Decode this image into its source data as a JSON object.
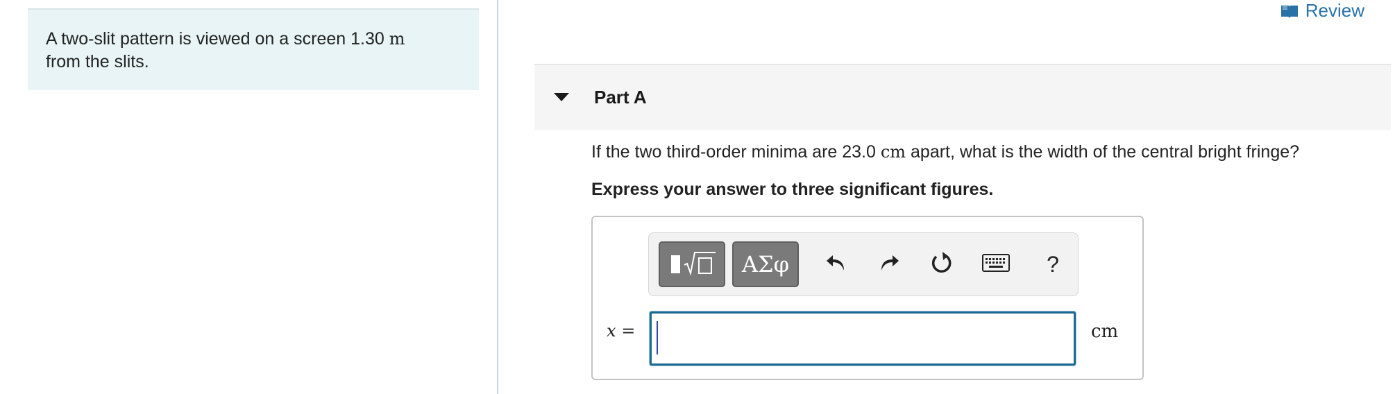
{
  "intro": {
    "text_before": "A two-slit pattern is viewed on a screen 1.30 ",
    "distance_unit": "m",
    "text_after": "from the slits."
  },
  "header": {
    "review_label": "Review",
    "review_icon": "book-icon"
  },
  "part": {
    "title": "Part A",
    "caret_icon": "caret-down-icon"
  },
  "question": {
    "text_before": "If the two third-order minima are 23.0 ",
    "unit": "cm",
    "text_after": " apart, what is the width of the central bright fringe?",
    "instruction": "Express your answer to three significant figures."
  },
  "toolbar": {
    "templates_icon": "templates-icon",
    "greek_label": "ΑΣφ",
    "undo_icon": "undo-icon",
    "redo_icon": "redo-icon",
    "reset_icon": "reset-icon",
    "keyboard_icon": "keyboard-icon",
    "help_label": "?"
  },
  "answer": {
    "variable": "x",
    "equals": "=",
    "value": "",
    "unit": "cm"
  },
  "colors": {
    "intro_background": "#e8f4f5",
    "link": "#2872a8",
    "input_border": "#1d6a90",
    "toolbar_button": "#7a7a7a"
  }
}
